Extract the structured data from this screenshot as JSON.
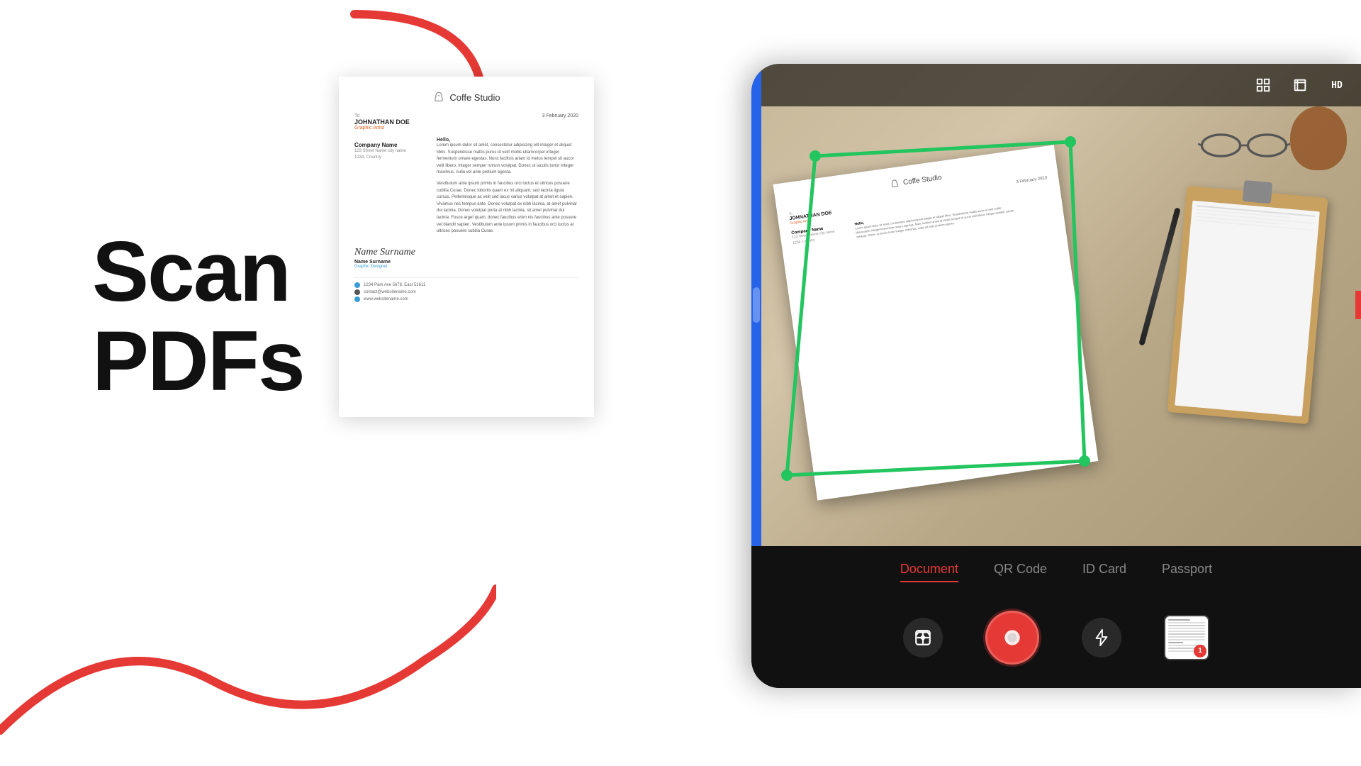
{
  "hero": {
    "line1": "Scan",
    "line2": "PDFs"
  },
  "brand": {
    "name": "Coffe Studio",
    "logo_symbol": "☕"
  },
  "document": {
    "to_label": "To",
    "name": "JOHNATHAN DOE",
    "title": "Graphic Artist",
    "date": "3 February 2020",
    "company_label": "Company Name",
    "address_line1": "123 Street Name city name",
    "address_line2": "1234, Country",
    "hello": "Hello,",
    "body_short": "Lorem ipsum dolor sit amet, consectetur adipiscing elit integer et aliquet libris. Suspendisse mattis purus id velit mollis ullamcorper integer fermentum ornare egestas. Nunc facilisis ariam id metus tempel sit aucor velit libero, integer semper rutrum volutpat. Donec ut iaculis tortor integer maximus, nulla vel ante pretium egesta.",
    "body_para2": "Vestibulum ante ipsum primis in faucibus orci luctus et ultrices posuere cubilia Curae. Donec lobortis quam ex mi aliquam, sed lacinia ligula cursus. Pellentesque ac velit sed lacus varius volutpat at amet et sapien. Vivamus nec tempus ante. Donec volutpat ex nibh lacinia, at amet pulvinar dui lacinia. Donec volutpat porta at nibh lacinia, sit amet pulvinar dui lacinia. Fusce arget quam, donec faucibus enim nis faucibus ante posuere vel blandit sapien. Vestibulum ante ipsum primis in faucibus orci luctus at ultrices posuere cubilia Curae.",
    "sig_script": "Name Surname",
    "sig_name": "Name Surname",
    "sig_role": "Graphic Designer",
    "footer_address": "1234 Park Ave 5678, East 51611",
    "footer_email": "contact@websitename.com",
    "footer_web": "www.websitename.com"
  },
  "camera": {
    "tabs": [
      {
        "id": "document",
        "label": "Document",
        "active": true
      },
      {
        "id": "qr-code",
        "label": "QR Code",
        "active": false
      },
      {
        "id": "id-card",
        "label": "ID Card",
        "active": false
      },
      {
        "id": "passport",
        "label": "Passport",
        "active": false
      }
    ],
    "toolbar_icons": [
      {
        "name": "grid-icon",
        "symbol": "⊞"
      },
      {
        "name": "crop-icon",
        "symbol": "⊟"
      },
      {
        "name": "hd-icon",
        "symbol": "HD"
      }
    ],
    "badge_count": "1"
  },
  "colors": {
    "accent_red": "#e53935",
    "accent_blue": "#2563eb",
    "accent_green": "#22c55e",
    "bg_dark": "#111111",
    "active_tab": "#e53935"
  }
}
